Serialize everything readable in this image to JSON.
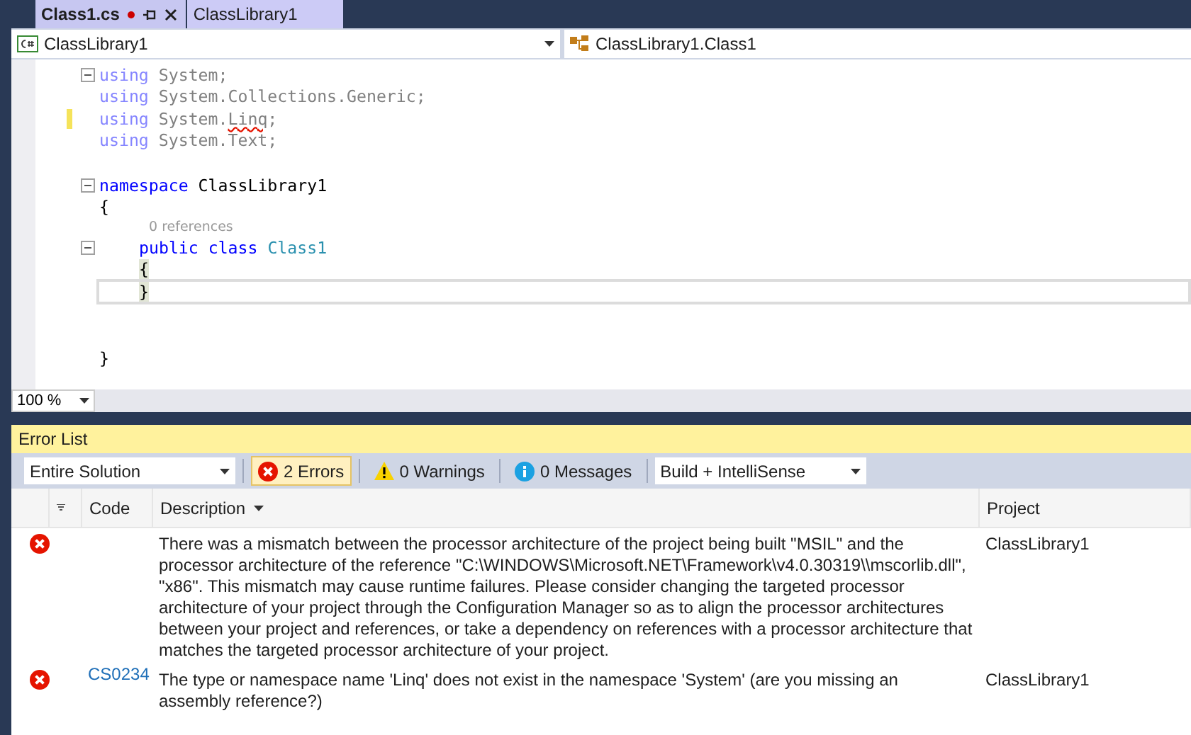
{
  "tabs": [
    {
      "label": "Class1.cs",
      "selected": true,
      "modified": true
    },
    {
      "label": "ClassLibrary1",
      "selected": false,
      "modified": false
    }
  ],
  "nav": {
    "project": "ClassLibrary1",
    "member": "ClassLibrary1.Class1"
  },
  "code": [
    {
      "kind": "code",
      "fold": true,
      "changed": false,
      "current": false,
      "tokens": [
        {
          "text": "using",
          "kind": "faded_keyword"
        },
        {
          "text": " System;",
          "kind": "faded"
        }
      ]
    },
    {
      "kind": "code",
      "fold": false,
      "changed": false,
      "current": false,
      "tokens": [
        {
          "text": "using",
          "kind": "faded_keyword"
        },
        {
          "text": " System.Collections.Generic;",
          "kind": "faded"
        }
      ]
    },
    {
      "kind": "code",
      "fold": false,
      "changed": true,
      "current": false,
      "tokens": [
        {
          "text": "using",
          "kind": "faded_keyword"
        },
        {
          "text": " System.",
          "kind": "faded"
        },
        {
          "text": "Linq",
          "kind": "squiggle"
        },
        {
          "text": ";",
          "kind": "faded"
        }
      ]
    },
    {
      "kind": "code",
      "fold": false,
      "changed": false,
      "current": false,
      "tokens": [
        {
          "text": "using",
          "kind": "faded_keyword"
        },
        {
          "text": " System.Text;",
          "kind": "faded"
        }
      ]
    },
    {
      "kind": "blank"
    },
    {
      "kind": "code",
      "fold": true,
      "changed": false,
      "current": false,
      "tokens": [
        {
          "text": "namespace",
          "kind": "keyword"
        },
        {
          "text": " ClassLibrary1",
          "kind": "plain"
        }
      ]
    },
    {
      "kind": "code",
      "fold": false,
      "changed": false,
      "current": false,
      "tokens": [
        {
          "text": "{",
          "kind": "plain"
        }
      ]
    },
    {
      "kind": "lens",
      "text": "0 references"
    },
    {
      "kind": "code",
      "fold": true,
      "changed": false,
      "current": false,
      "indented": true,
      "tokens": [
        {
          "text": "public",
          "kind": "keyword"
        },
        {
          "text": "class",
          "kind": "keyword"
        },
        {
          "text": "Class1",
          "kind": "type"
        }
      ]
    },
    {
      "kind": "code",
      "fold": false,
      "changed": false,
      "current": false,
      "indented": true,
      "tokens": [
        {
          "text": "{",
          "kind": "brace"
        }
      ]
    },
    {
      "kind": "code",
      "fold": false,
      "changed": false,
      "current": true,
      "indented": true,
      "tokens": [
        {
          "text": "}",
          "kind": "brace"
        }
      ]
    },
    {
      "kind": "blank"
    },
    {
      "kind": "blank"
    },
    {
      "kind": "code",
      "fold": false,
      "changed": false,
      "current": false,
      "tokens": [
        {
          "text": "}",
          "kind": "plain"
        }
      ]
    }
  ],
  "zoom": "100 %",
  "error_list": {
    "title": "Error List",
    "scope": "Entire Solution",
    "filters": [
      {
        "kind": "error",
        "label": "2 Errors",
        "selected": true
      },
      {
        "kind": "warning",
        "label": "0 Warnings",
        "selected": false
      },
      {
        "kind": "message",
        "label": "0 Messages",
        "selected": false
      }
    ],
    "source": "Build + IntelliSense",
    "columns": [
      {
        "label": "Code",
        "sorted": false
      },
      {
        "label": "Description",
        "sorted": true
      },
      {
        "label": "Project",
        "sorted": false
      }
    ],
    "rows": [
      {
        "kind": "error",
        "description": "There was a mismatch between the processor architecture of the project being built \"MSIL\" and the processor architecture of the reference \"C:\\WINDOWS\\Microsoft.NET\\Framework\\v4.0.30319\\\\mscorlib.dll\", \"x86\". This mismatch may cause runtime failures. Please consider changing the targeted processor architecture of your project through the Configuration Manager so as to align the processor architectures between your project and references, or take a dependency on references with a processor architecture that matches the targeted processor architecture of your project.",
        "project": "ClassLibrary1"
      },
      {
        "kind": "error",
        "code": "CS0234",
        "description": "The type or namespace name 'Linq' does not exist in the namespace 'System' (are you missing an assembly reference?)",
        "project": "ClassLibrary1"
      }
    ]
  }
}
